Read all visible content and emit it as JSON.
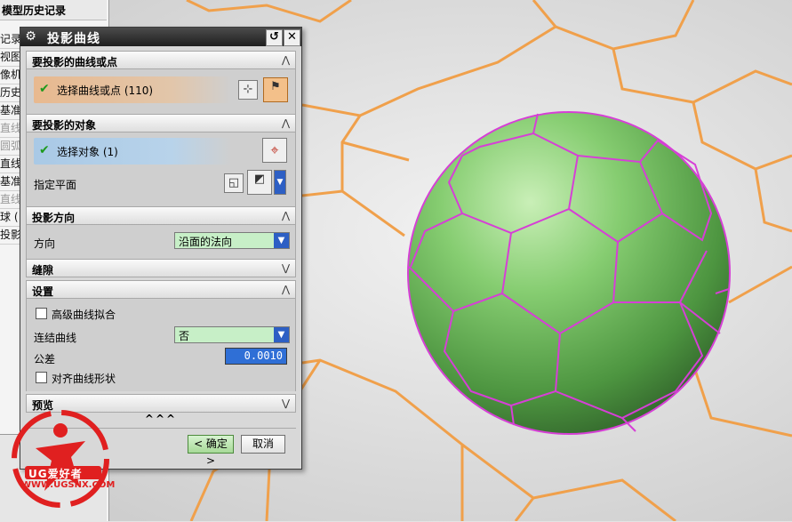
{
  "navigator": {
    "title": "模型历史记录",
    "rows": [
      {
        "text": "记录模",
        "dim": false
      },
      {
        "text": "视图",
        "dim": false
      },
      {
        "text": "像机",
        "dim": false
      },
      {
        "text": "历史记",
        "dim": false
      },
      {
        "text": "基准",
        "dim": false
      },
      {
        "text": "直线",
        "dim": true
      },
      {
        "text": "圆弧",
        "dim": true
      },
      {
        "text": "直线",
        "dim": false
      },
      {
        "text": "基准",
        "dim": false
      },
      {
        "text": "直线",
        "dim": true
      },
      {
        "text": "球 (",
        "dim": false
      },
      {
        "text": "投影",
        "dim": false
      }
    ]
  },
  "dialog": {
    "title": "投影曲线",
    "sections": {
      "curves": {
        "header": "要投影的曲线或点",
        "select_label": "选择曲线或点 (110)"
      },
      "objects": {
        "header": "要投影的对象",
        "select_label": "选择对象 (1)",
        "plane_label": "指定平面"
      },
      "direction": {
        "header": "投影方向",
        "direction_label": "方向",
        "direction_value": "沿面的法向"
      },
      "gaps": {
        "header": "缝隙"
      },
      "settings": {
        "header": "设置",
        "advanced_fit_label": "高级曲线拟合",
        "join_label": "连结曲线",
        "join_value": "否",
        "tolerance_label": "公差",
        "tolerance_value": "0.0010",
        "align_label": "对齐曲线形状"
      },
      "preview": {
        "header": "预览",
        "more": "^^^"
      }
    },
    "buttons": {
      "ok": "< 确定 >",
      "cancel": "取消"
    }
  },
  "watermark": {
    "brand": "UG爱好者",
    "url": "WWW.UGSNX.COM"
  },
  "colors": {
    "hex_grid": "#f0a04b",
    "sphere_base": "#7cc26a",
    "projected_curves": "#d63fd6",
    "selection_orange": "#e8b98f",
    "selection_blue": "#a9c9e6"
  }
}
